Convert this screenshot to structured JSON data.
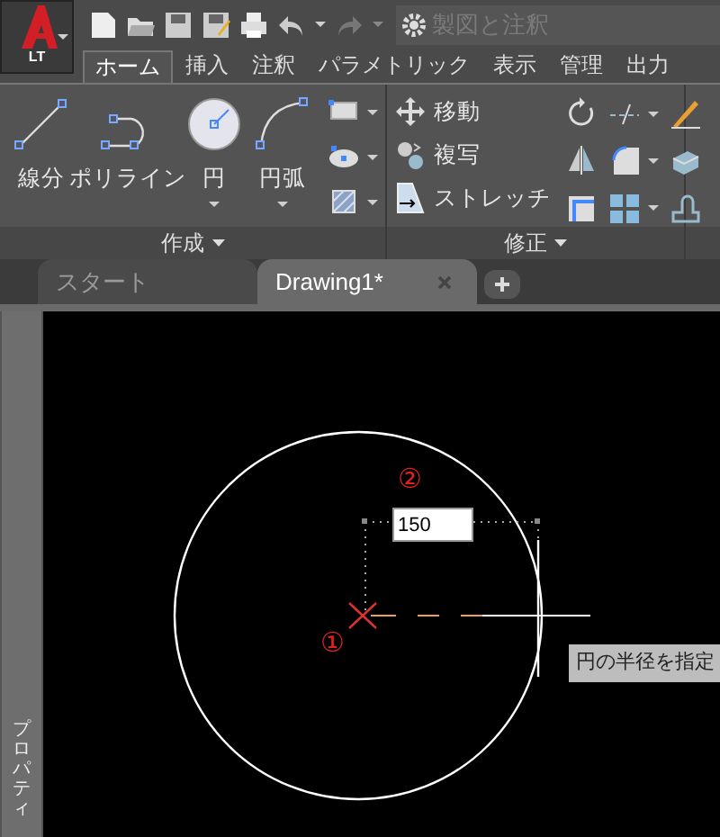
{
  "app_button": {
    "label": "LT"
  },
  "quick_access": {
    "workspace": "製図と注釈"
  },
  "ribbon_tabs": [
    {
      "label": "ホーム",
      "selected": true
    },
    {
      "label": "挿入",
      "selected": false
    },
    {
      "label": "注釈",
      "selected": false
    },
    {
      "label": "パラメトリック",
      "selected": false
    },
    {
      "label": "表示",
      "selected": false
    },
    {
      "label": "管理",
      "selected": false
    },
    {
      "label": "出力",
      "selected": false
    }
  ],
  "draw_panel": {
    "title": "作成",
    "tools": [
      {
        "label": "線分",
        "kind": "line",
        "has_menu": false
      },
      {
        "label": "ポリライン",
        "kind": "polyline",
        "has_menu": false
      },
      {
        "label": "円",
        "kind": "circle",
        "has_menu": true
      },
      {
        "label": "円弧",
        "kind": "arc",
        "has_menu": true
      }
    ]
  },
  "modify_panel": {
    "title": "修正",
    "tools": [
      {
        "label": "移動",
        "kind": "move"
      },
      {
        "label": "複写",
        "kind": "copy"
      },
      {
        "label": "ストレッチ",
        "kind": "stretch"
      }
    ]
  },
  "doc_tabs": [
    {
      "label": "スタート",
      "selected": false
    },
    {
      "label": "Drawing1*",
      "selected": true
    }
  ],
  "palette": {
    "label": "プロパティ"
  },
  "canvas": {
    "dynamic_input": "150",
    "tooltip": "円の半径を指定",
    "marker_radius": "②",
    "marker_center": "①"
  }
}
